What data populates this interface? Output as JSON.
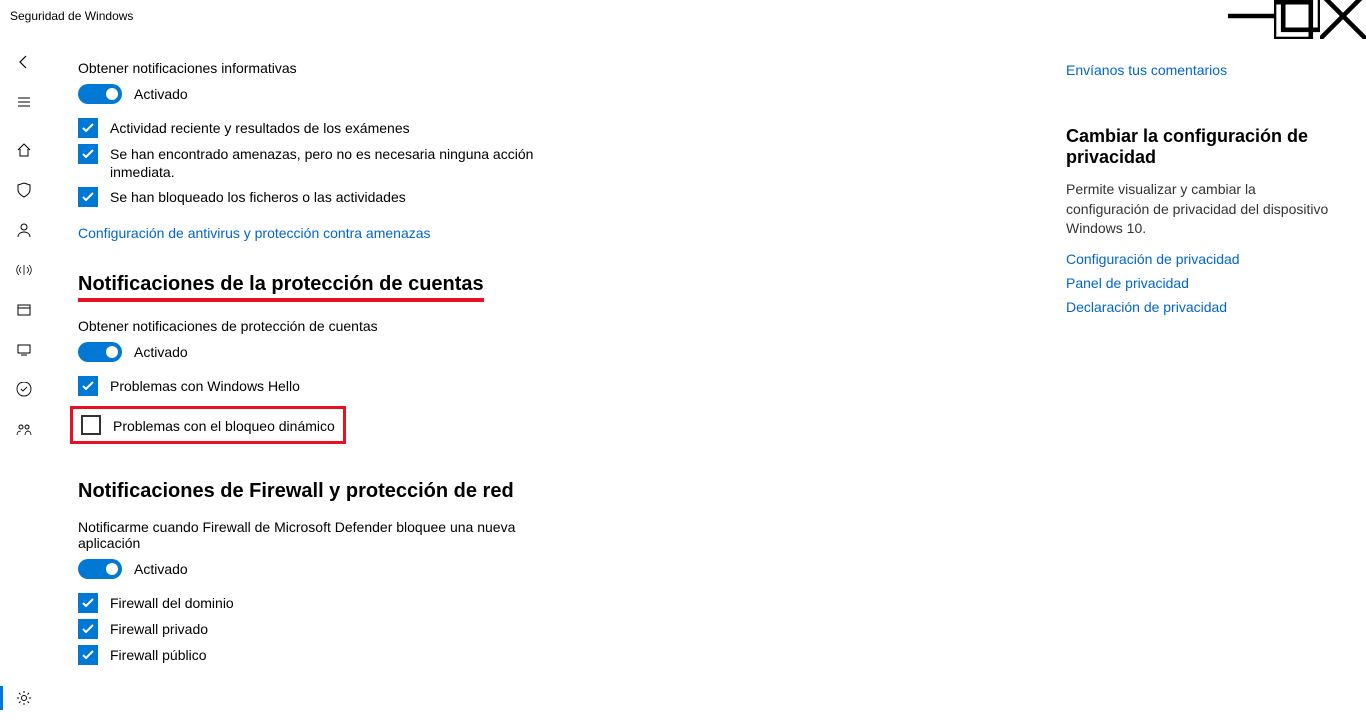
{
  "window": {
    "title": "Seguridad de Windows"
  },
  "section1": {
    "subtitle": "Obtener notificaciones informativas",
    "toggle_state": "Activado",
    "check1": "Actividad reciente y resultados de los exámenes",
    "check2": "Se han encontrado amenazas, pero no es necesaria ninguna acción inmediata.",
    "check3": "Se han bloqueado los ficheros o las actividades",
    "link": "Configuración de antivirus y protección contra amenazas"
  },
  "section2": {
    "title": "Notificaciones de la protección de cuentas",
    "subtitle": "Obtener notificaciones de protección de cuentas",
    "toggle_state": "Activado",
    "check1": "Problemas con Windows Hello",
    "check2": "Problemas con el bloqueo dinámico"
  },
  "section3": {
    "title": "Notificaciones de Firewall y protección de red",
    "subtitle": "Notificarme cuando Firewall de Microsoft Defender bloquee una nueva aplicación",
    "toggle_state": "Activado",
    "check1": "Firewall del dominio",
    "check2": "Firewall privado",
    "check3": "Firewall público"
  },
  "right": {
    "feedback": "Envíanos tus comentarios",
    "privacy_heading": "Cambiar la configuración de privacidad",
    "privacy_text": "Permite visualizar y cambiar la configuración de privacidad del dispositivo Windows 10.",
    "link1": "Configuración de privacidad",
    "link2": "Panel de privacidad",
    "link3": "Declaración de privacidad"
  }
}
